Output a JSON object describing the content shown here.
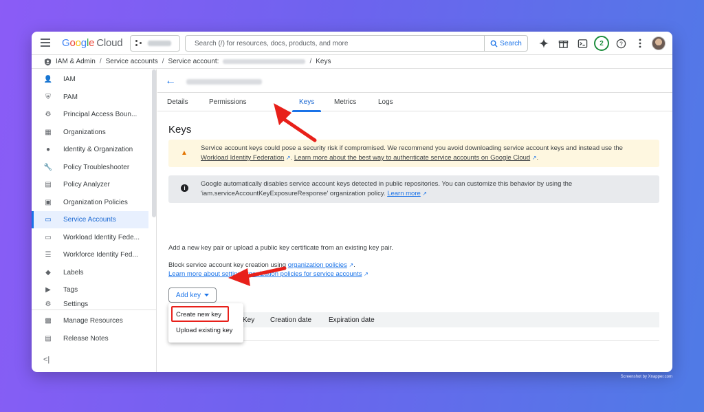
{
  "topbar": {
    "logo_google": [
      "G",
      "o",
      "o",
      "g",
      "l",
      "e"
    ],
    "logo_cloud": "Cloud",
    "search_placeholder": "Search (/) for resources, docs, products, and more",
    "search_button": "Search",
    "notification_count": "2",
    "icons": [
      "menu-icon",
      "gemini-sparkle-icon",
      "gift-icon",
      "terminal-icon",
      "help-icon",
      "more-vert-icon"
    ]
  },
  "breadcrumb": {
    "items": [
      "IAM & Admin",
      "Service accounts",
      "Service account:",
      "Keys"
    ],
    "separator": "/"
  },
  "sidebar": {
    "items": [
      {
        "label": "IAM",
        "icon": "person-add-icon",
        "glyph": "👤"
      },
      {
        "label": "PAM",
        "icon": "shield-icon",
        "glyph": "⛨"
      },
      {
        "label": "Principal Access Boun...",
        "icon": "policy-icon",
        "glyph": "⚙"
      },
      {
        "label": "Organizations",
        "icon": "domain-icon",
        "glyph": "▦"
      },
      {
        "label": "Identity & Organization",
        "icon": "account-circle-icon",
        "glyph": "●"
      },
      {
        "label": "Policy Troubleshooter",
        "icon": "wrench-icon",
        "glyph": "🔧"
      },
      {
        "label": "Policy Analyzer",
        "icon": "document-search-icon",
        "glyph": "▤"
      },
      {
        "label": "Organization Policies",
        "icon": "article-icon",
        "glyph": "▣"
      },
      {
        "label": "Service Accounts",
        "icon": "service-account-icon",
        "glyph": "▭"
      },
      {
        "label": "Workload Identity Fede...",
        "icon": "badge-icon",
        "glyph": "▭"
      },
      {
        "label": "Workforce Identity Fed...",
        "icon": "list-icon",
        "glyph": "☰"
      },
      {
        "label": "Labels",
        "icon": "label-icon",
        "glyph": "◆"
      },
      {
        "label": "Tags",
        "icon": "tag-icon",
        "glyph": "▶"
      },
      {
        "label": "Settings",
        "icon": "settings-icon",
        "glyph": "⚙"
      }
    ],
    "active_index": 8,
    "bottom_items": [
      {
        "label": "Manage Resources",
        "icon": "folder-icon",
        "glyph": "▩"
      },
      {
        "label": "Release Notes",
        "icon": "release-notes-icon",
        "glyph": "▤"
      }
    ],
    "collapse_label": "<|"
  },
  "main": {
    "back_glyph": "←",
    "tabs": [
      "Details",
      "Permissions",
      "Keys",
      "Metrics",
      "Logs"
    ],
    "active_tab": "Keys",
    "heading": "Keys",
    "warning": {
      "text1": "Service account keys could pose a security risk if compromised. We recommend you avoid downloading service account keys and instead use the ",
      "link1": "Workload Identity Federation",
      "link2": "Learn more about the best way to authenticate service accounts on Google Cloud",
      "glyph": "▲"
    },
    "info": {
      "text1": "Google automatically disables service account keys detected in public repositories. You can customize this behavior by using the 'iam.serviceAccountKeyExposureResponse' organization policy. ",
      "link": "Learn more",
      "glyph": "i"
    },
    "add_key_text": "Add a new key pair or upload a public key certificate from an existing key pair.",
    "block_text": "Block service account key creation using ",
    "org_policies_link": "organization policies",
    "learn_policies_link": "Learn more about setting organization policies for service accounts",
    "add_key_button": "Add key",
    "dropdown_items": [
      "Create new key",
      "Upload existing key"
    ],
    "table_columns": [
      "Key",
      "Creation date",
      "Expiration date"
    ]
  },
  "annotation_color": "#e8201a",
  "watermark": "Screenshot by Xnapper.com"
}
